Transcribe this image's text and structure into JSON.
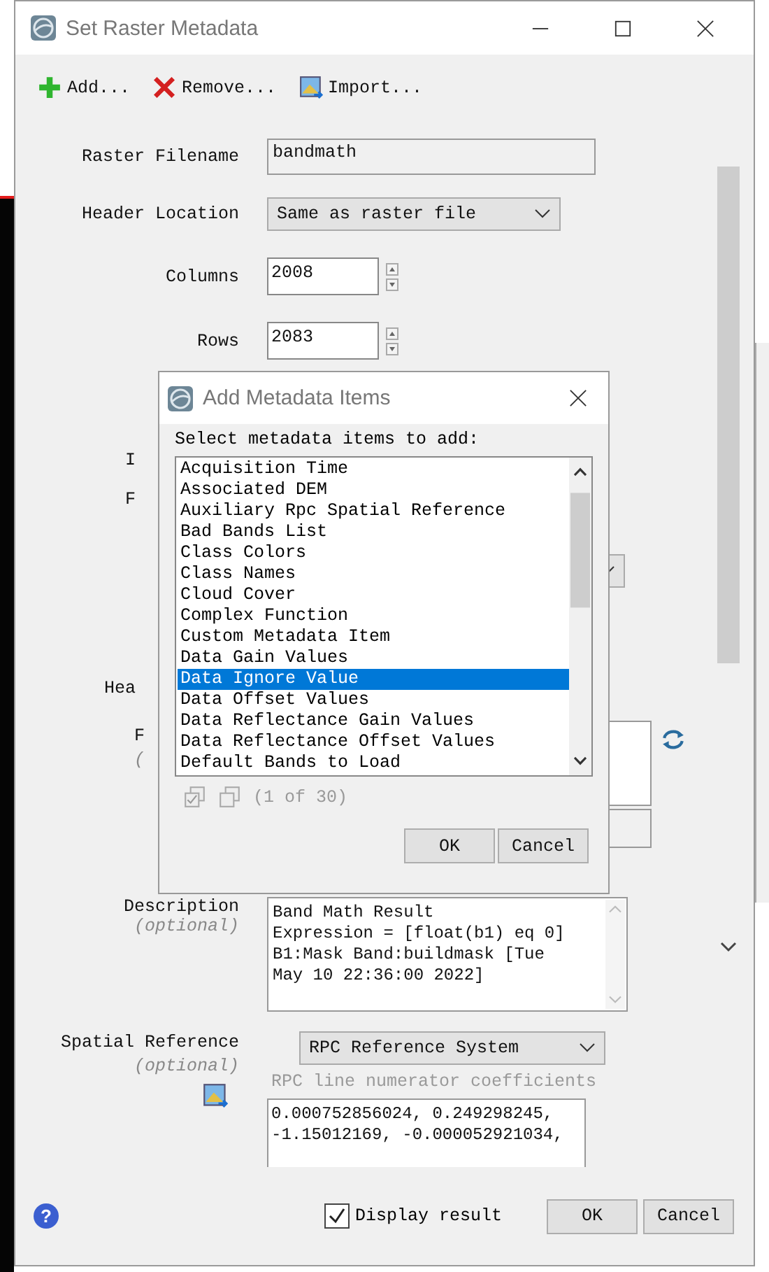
{
  "window": {
    "title": "Set Raster Metadata"
  },
  "toolbar": [
    {
      "kind": "add",
      "label": "Add..."
    },
    {
      "kind": "remove",
      "label": "Remove..."
    },
    {
      "kind": "import",
      "label": "Import..."
    }
  ],
  "form": [
    {
      "kind": "text",
      "label": "Raster Filename",
      "value": "bandmath"
    },
    {
      "kind": "select",
      "label": "Header Location",
      "value": "Same as raster file"
    },
    {
      "kind": "spin",
      "label": "Columns",
      "value": "2008"
    },
    {
      "kind": "spin",
      "label": "Rows",
      "value": "2083"
    },
    {
      "kind": "covered",
      "label": "I"
    },
    {
      "kind": "covered-select",
      "label": "F"
    },
    {
      "kind": "covered",
      "label": "Hea"
    },
    {
      "kind": "covered-area",
      "label": "F",
      "hint": "("
    },
    {
      "kind": "area",
      "label": "Description",
      "hint": "(optional)",
      "value": "Band Math Result\nExpression = [float(b1) eq 0]\nB1:Mask Band:buildmask [Tue\nMay 10 22:36:00 2022]"
    },
    {
      "kind": "spatial",
      "label": "Spatial Reference",
      "hint": "(optional)",
      "value": "RPC Reference System",
      "caption": "RPC line numerator coefficients",
      "coefficients": "0.000752856024, 0.249298245,\n-1.15012169, -0.000052921034,"
    }
  ],
  "display_result": {
    "label": "Display result",
    "checked": true
  },
  "help": "?",
  "buttons": [
    "OK",
    "Cancel"
  ],
  "dialog": {
    "title": "Add Metadata Items",
    "prompt": "Select metadata items to add:",
    "items": [
      {
        "label": "Acquisition Time",
        "selected": false
      },
      {
        "label": "Associated DEM",
        "selected": false
      },
      {
        "label": "Auxiliary Rpc Spatial Reference",
        "selected": false
      },
      {
        "label": "Bad Bands List",
        "selected": false
      },
      {
        "label": "Class Colors",
        "selected": false
      },
      {
        "label": "Class Names",
        "selected": false
      },
      {
        "label": "Cloud Cover",
        "selected": false
      },
      {
        "label": "Complex Function",
        "selected": false
      },
      {
        "label": "Custom Metadata Item",
        "selected": false
      },
      {
        "label": "Data Gain Values",
        "selected": false
      },
      {
        "label": "Data Ignore Value",
        "selected": true
      },
      {
        "label": "Data Offset Values",
        "selected": false
      },
      {
        "label": "Data Reflectance Gain Values",
        "selected": false
      },
      {
        "label": "Data Reflectance Offset Values",
        "selected": false
      },
      {
        "label": "Default Bands to Load",
        "selected": false
      }
    ],
    "count": "(1 of 30)",
    "buttons": [
      "OK",
      "Cancel"
    ]
  }
}
